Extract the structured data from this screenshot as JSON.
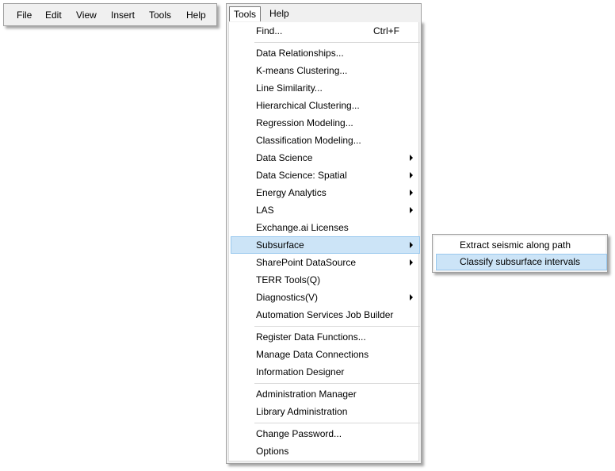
{
  "menubar": {
    "items": [
      "File",
      "Edit",
      "View",
      "Insert",
      "Tools",
      "Help"
    ]
  },
  "open_menubar": {
    "tools": "Tools",
    "help": "Help"
  },
  "tools_menu": {
    "find": {
      "label": "Find...",
      "shortcut": "Ctrl+F"
    },
    "items": [
      "Data Relationships...",
      "K-means Clustering...",
      "Line Similarity...",
      "Hierarchical Clustering...",
      "Regression Modeling...",
      "Classification Modeling...",
      "Data Science",
      "Data Science: Spatial",
      "Energy Analytics",
      "LAS",
      "Exchange.ai Licenses",
      "Subsurface",
      "SharePoint DataSource",
      "TERR Tools(Q)",
      "Diagnostics(V)",
      "Automation Services Job Builder",
      "Register Data Functions...",
      "Manage Data Connections",
      "Information Designer",
      "Administration Manager",
      "Library Administration",
      "Change Password...",
      "Options"
    ],
    "highlighted": "Subsurface"
  },
  "subsurface_submenu": {
    "items": [
      "Extract seismic along path",
      "Classify subsurface intervals"
    ],
    "highlighted": "Classify subsurface intervals"
  },
  "colors": {
    "menu_background": "#f0f0f0",
    "highlight": "#cce4f7",
    "highlight_border": "#99c8ee"
  }
}
